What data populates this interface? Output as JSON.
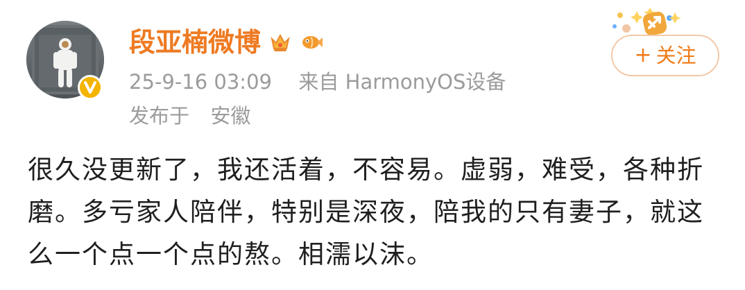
{
  "post": {
    "author": {
      "name": "段亚楠微博",
      "verified": true,
      "badges": [
        "crown-icon",
        "fish-icon"
      ]
    },
    "meta": {
      "time": "25-9-16 03:09",
      "source_prefix": "来自",
      "source": "HarmonyOS设备",
      "location_prefix": "发布于",
      "location": "安徽"
    },
    "follow_label": "关注",
    "follow_plus": "+",
    "text": "很久没更新了，我还活着，不容易。虚弱，难受，各种折磨。多亏家人陪伴，特别是深夜，陪我的只有妻子，就这么一个点一个点的熬。相濡以沫。"
  },
  "colors": {
    "username": "#ee7a22",
    "meta": "#9b9b9b",
    "follow": "#ef7a16",
    "follow_border": "#f3c9a8",
    "verified": "#f4b400"
  }
}
